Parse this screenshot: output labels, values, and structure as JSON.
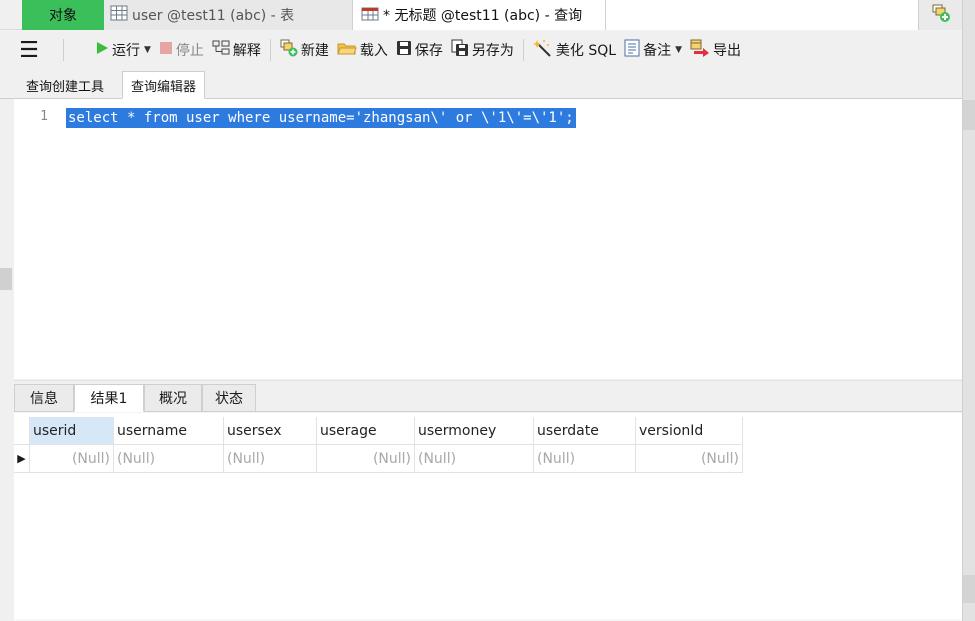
{
  "tabs": {
    "objects": "对象",
    "table_tab": "user @test11 (abc) - 表",
    "query_tab": "* 无标题 @test11 (abc) - 查询"
  },
  "toolbar": {
    "run": "运行",
    "stop": "停止",
    "explain": "解释",
    "new": "新建",
    "load": "载入",
    "save": "保存",
    "save_as": "另存为",
    "beautify": "美化 SQL",
    "comment": "备注",
    "export": "导出"
  },
  "subtabs": {
    "builder": "查询创建工具",
    "editor": "查询编辑器"
  },
  "editor": {
    "line_number": "1",
    "code": "select * from user where username='zhangsan\\' or \\'1\\'=\\'1';"
  },
  "result_tabs": {
    "info": "信息",
    "result1": "结果1",
    "overview": "概况",
    "status": "状态"
  },
  "grid": {
    "columns": [
      "userid",
      "username",
      "usersex",
      "userage",
      "usermoney",
      "userdate",
      "versionId"
    ],
    "row": [
      "(Null)",
      "(Null)",
      "(Null)",
      "(Null)",
      "(Null)",
      "(Null)",
      "(Null)"
    ]
  },
  "colors": {
    "accent_green": "#3bbf5b",
    "selection_blue": "#2e7be0",
    "header_selected": "#d6e8f8"
  }
}
